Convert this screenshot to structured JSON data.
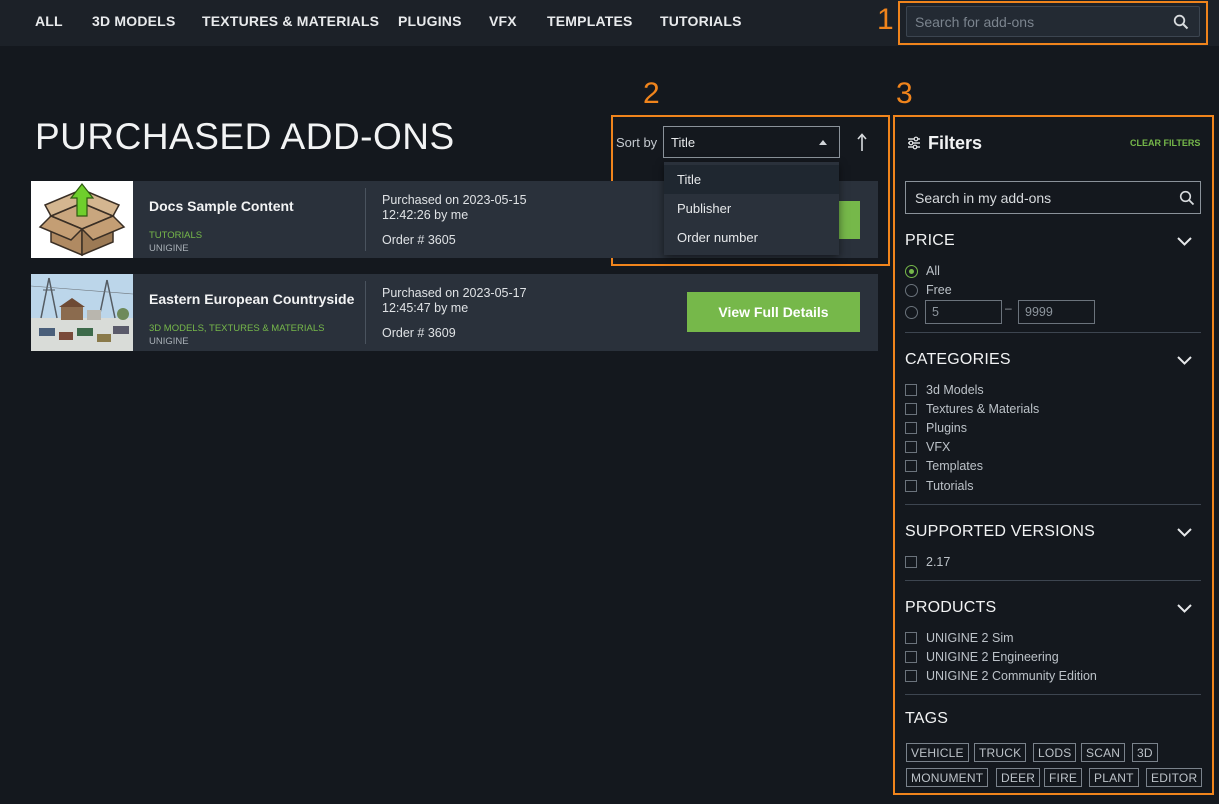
{
  "nav": {
    "items": [
      "ALL",
      "3D MODELS",
      "TEXTURES & MATERIALS",
      "PLUGINS",
      "VFX",
      "TEMPLATES",
      "TUTORIALS"
    ],
    "search_placeholder": "Search for add-ons"
  },
  "annotations": [
    "1",
    "2",
    "3"
  ],
  "page_title": "PURCHASED ADD-ONS",
  "sort": {
    "label": "Sort by",
    "selected": "Title",
    "options": [
      "Title",
      "Publisher",
      "Order number"
    ],
    "direction_icon": "arrow-up-icon"
  },
  "cards": [
    {
      "title": "Docs Sample Content",
      "category": "TUTORIALS",
      "publisher": "UNIGINE",
      "purchased_line1": "Purchased on 2023-05-15",
      "purchased_line2": "12:42:26 by me",
      "order": "Order # 3605",
      "thumb_icon": "box-upload-icon"
    },
    {
      "title": "Eastern European Countryside",
      "category_parts": [
        "3D MODELS",
        ", ",
        "TEXTURES & MATERIALS"
      ],
      "publisher": "UNIGINE",
      "purchased_line1": "Purchased on 2023-05-17",
      "purchased_line2": "12:45:47 by me",
      "order": "Order # 3609",
      "button": "View Full Details",
      "thumb_icon": "countryside-scene-image"
    }
  ],
  "filters": {
    "title": "Filters",
    "clear": "CLEAR FILTERS",
    "search_placeholder": "Search in my add-ons",
    "price": {
      "title": "PRICE",
      "options": [
        "All",
        "Free"
      ],
      "selected": "All",
      "min": "5",
      "max": "9999",
      "dash": "–"
    },
    "categories": {
      "title": "CATEGORIES",
      "options": [
        "3d Models",
        "Textures & Materials",
        "Plugins",
        "VFX",
        "Templates",
        "Tutorials"
      ]
    },
    "versions": {
      "title": "SUPPORTED VERSIONS",
      "options": [
        "2.17"
      ]
    },
    "products": {
      "title": "PRODUCTS",
      "options": [
        "UNIGINE 2 Sim",
        "UNIGINE 2 Engineering",
        "UNIGINE 2 Community Edition"
      ]
    },
    "tags": {
      "title": "TAGS",
      "row1": [
        "VEHICLE",
        "TRUCK",
        "LODS",
        "SCAN",
        "3D"
      ],
      "row2": [
        "MONUMENT",
        "DEER",
        "FIRE",
        "PLANT",
        "EDITOR"
      ]
    }
  },
  "colors": {
    "background": "#14181e",
    "nav_bg": "#1c2128",
    "card_bg": "#2a313b",
    "accent_green": "#76b84a",
    "annotation_orange": "#f0841c"
  }
}
